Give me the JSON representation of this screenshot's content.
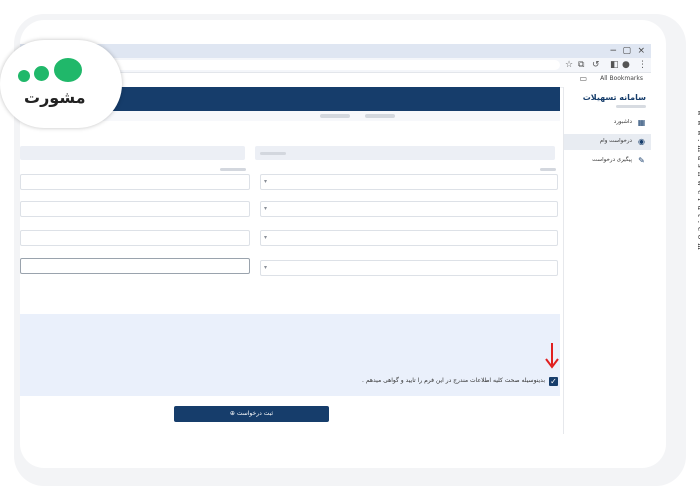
{
  "browser": {
    "window_controls": [
      "−",
      "▢",
      "×"
    ],
    "bookmarks_label": "All Bookmarks"
  },
  "sidebar": {
    "title": "سامانه تسهیلات",
    "items": [
      {
        "label": "داشبورد",
        "icon": "dashboard-icon"
      },
      {
        "label": "درخواست وام",
        "icon": "loan-request-icon"
      },
      {
        "label": "پیگیری درخواست",
        "icon": "track-request-icon"
      }
    ]
  },
  "agreement": {
    "label": "بدینوسیله صحت کلیه اطلاعات مندرج در این فرم را تایید و گواهی میدهم .",
    "checked": true
  },
  "submit": {
    "label": "ثبت درخواست"
  },
  "logo": {
    "text": "مشورت"
  },
  "watermark": {
    "text": "www.mashwerat.com"
  },
  "colors": {
    "primary": "#163d6b",
    "accent_green": "#20b86a",
    "arrow_red": "#e02020",
    "notes_bg": "#eaf0fb"
  }
}
